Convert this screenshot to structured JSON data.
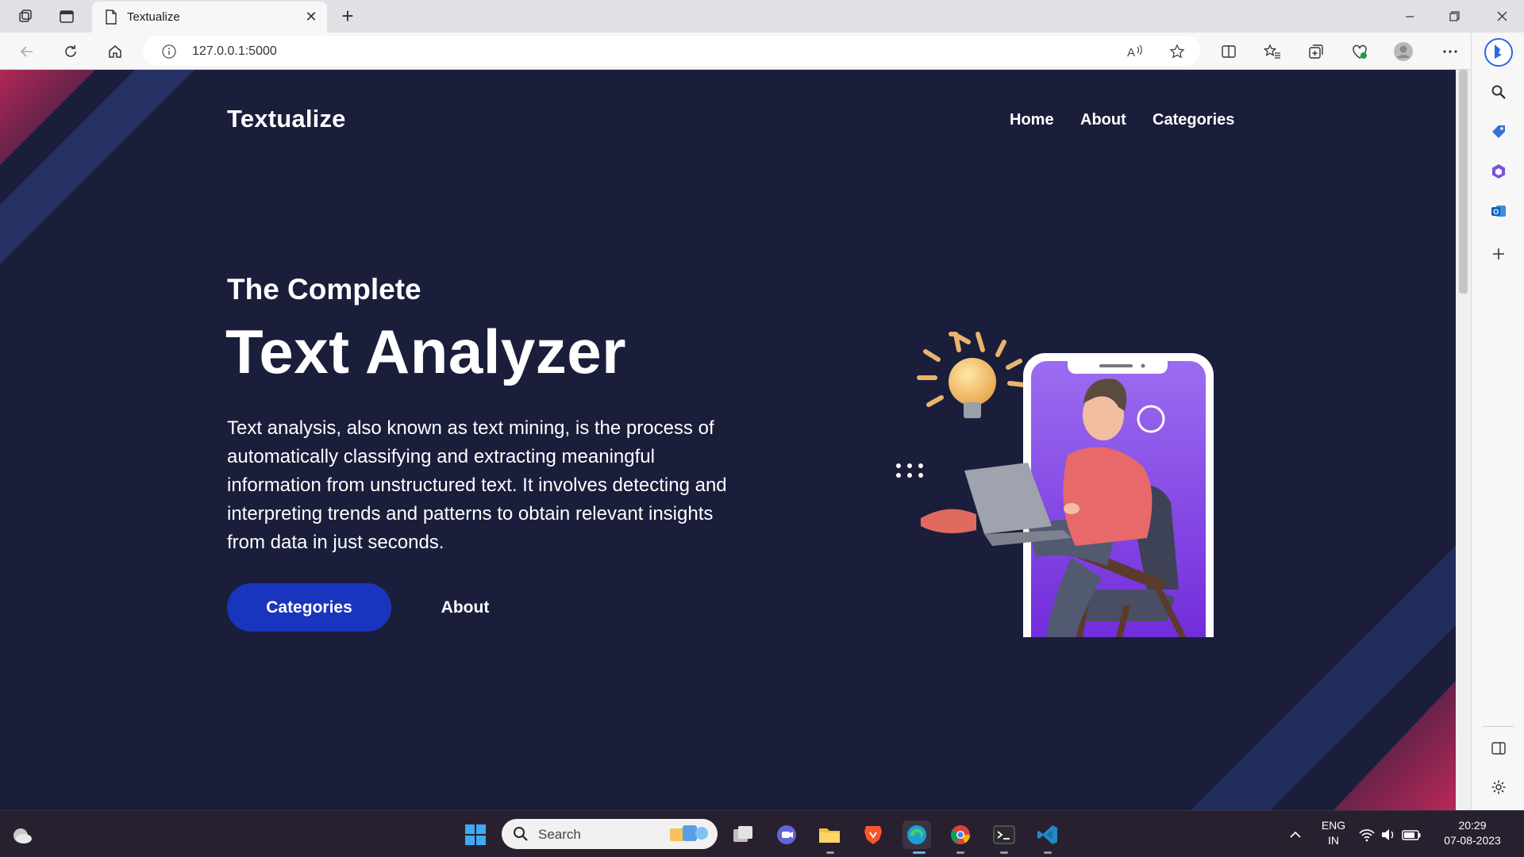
{
  "browser": {
    "tab_title": "Textualize",
    "url": "127.0.0.1:5000",
    "tab_close_glyph": "✕",
    "new_tab_glyph": "+"
  },
  "site": {
    "brand": "Textualize",
    "nav": [
      "Home",
      "About",
      "Categories"
    ]
  },
  "hero": {
    "subtitle": "The Complete",
    "title": "Text Analyzer",
    "description": "Text analysis, also known as text mining, is the process of automatically classifying and extracting meaningful information from unstructured text. It involves detecting and interpreting trends and patterns to obtain relevant insights from data in just seconds.",
    "primary_button": "Categories",
    "secondary_button": "About"
  },
  "taskbar": {
    "search_placeholder": "Search",
    "language": "ENG",
    "region": "IN",
    "time": "20:29",
    "date": "07-08-2023"
  },
  "colors": {
    "page_background": "#1a1e3b",
    "primary_button": "#1a35bd",
    "accent_stripe": "#2b3a7a",
    "accent_pink": "#c2285a",
    "phone_screen": "#8a44e8"
  }
}
